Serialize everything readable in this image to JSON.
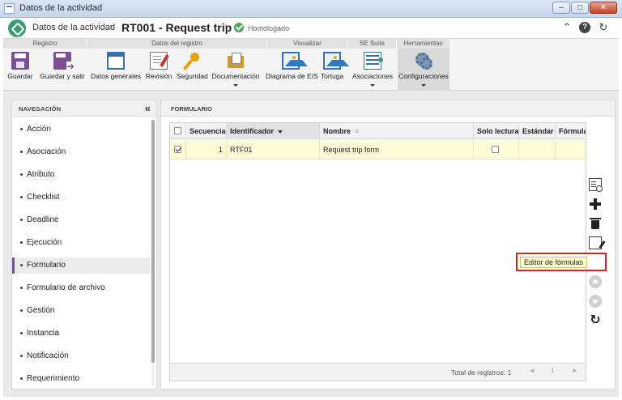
{
  "window": {
    "title": "Datos de la actividad",
    "buttons": {
      "minimize": "–",
      "maximize": "□",
      "close": "✕"
    }
  },
  "header": {
    "breadcrumb": "Datos de la actividad",
    "separator": "›",
    "record_title": "RT001 - Request trip",
    "status": "Homologado",
    "icons": {
      "collapse": "⌃",
      "help": "?",
      "refresh": "↻"
    }
  },
  "ribbon": {
    "groups": [
      {
        "label": "Registro"
      },
      {
        "label": "Datos del registro"
      },
      {
        "label": "Visualizar"
      },
      {
        "label": "SE Suite"
      },
      {
        "label": "Herramientas"
      }
    ],
    "buttons": [
      {
        "label": "Guardar",
        "icon": "save-icon"
      },
      {
        "label": "Guardar y salir",
        "icon": "save-exit-icon"
      },
      {
        "label": "Datos generales",
        "icon": "window-icon"
      },
      {
        "label": "Revisión",
        "icon": "review-icon"
      },
      {
        "label": "Seguridad",
        "icon": "key-icon"
      },
      {
        "label": "Documentación",
        "icon": "folder-icon"
      },
      {
        "label": "Diagrama de E/S",
        "icon": "picture-icon"
      },
      {
        "label": "Tortuga",
        "icon": "picture-icon"
      },
      {
        "label": "Asociaciones",
        "icon": "associations-icon"
      },
      {
        "label": "Configuraciones",
        "icon": "gears-icon"
      }
    ]
  },
  "navigation": {
    "title": "NAVEGACIÓN",
    "collapse_glyph": "«",
    "items": [
      {
        "label": "Acción"
      },
      {
        "label": "Asociación"
      },
      {
        "label": "Atributo"
      },
      {
        "label": "Checklist"
      },
      {
        "label": "Deadline"
      },
      {
        "label": "Ejecución"
      },
      {
        "label": "Formulario",
        "active": true
      },
      {
        "label": "Formulario de archivo"
      },
      {
        "label": "Gestión"
      },
      {
        "label": "Instancia"
      },
      {
        "label": "Notificación"
      },
      {
        "label": "Requerimiento"
      }
    ]
  },
  "formulario": {
    "title": "FORMULARIO",
    "columns": [
      {
        "label": ""
      },
      {
        "label": "Secuencia"
      },
      {
        "label": "Identificador"
      },
      {
        "label": "Nombre"
      },
      {
        "label": "Solo lectura"
      },
      {
        "label": "Estándar"
      },
      {
        "label": "Fórmula"
      }
    ],
    "rows": [
      {
        "selected": true,
        "secuencia": "1",
        "identificador": "RTF01",
        "nombre": "Request trip form",
        "solo_lectura": false,
        "estandar": "",
        "formula": ""
      }
    ],
    "footer": {
      "total": "Total de registros: 1",
      "page": "1",
      "prev_glyph": "◄",
      "next_glyph": "►"
    }
  },
  "toolbar": {
    "items": [
      "find-icon",
      "add-icon",
      "delete-icon",
      "edit-icon",
      "formula-icon",
      "move-up-icon",
      "move-down-icon",
      "refresh-icon"
    ],
    "fx_glyph": "fx",
    "refresh_glyph": "↻",
    "tooltip": "Editor de fórmulas"
  },
  "colors": {
    "accent": "#7a4f96",
    "selected_row": "#fffbd6",
    "highlight_border": "#d32424",
    "status_green": "#54a35f"
  }
}
